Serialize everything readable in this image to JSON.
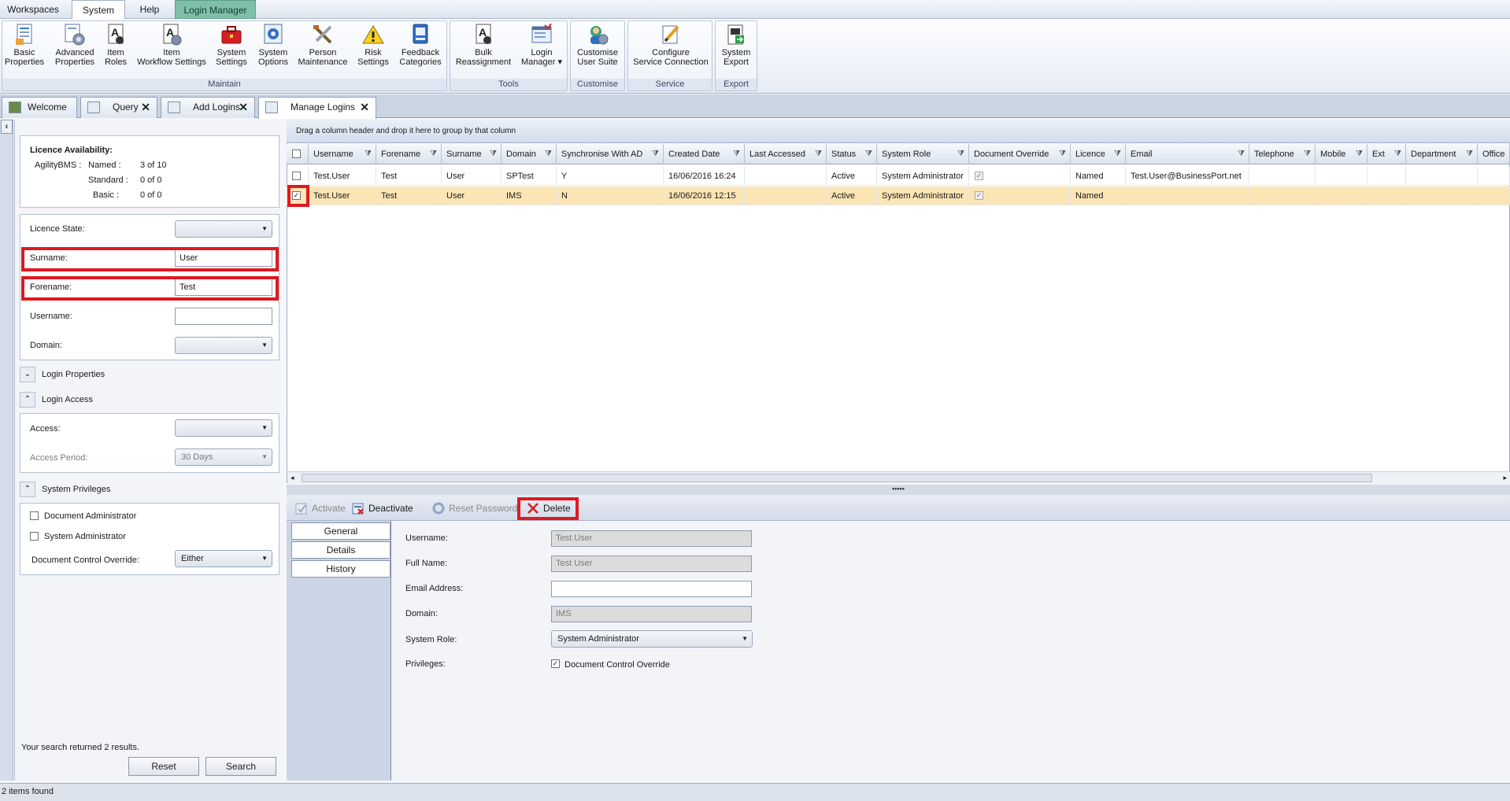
{
  "menu": {
    "tabs": [
      "Workspaces",
      "System",
      "Help",
      "Login Manager"
    ]
  },
  "ribbon": {
    "groups": [
      "Maintain",
      "Tools",
      "Customise",
      "Service",
      "Export"
    ],
    "buttons": [
      {
        "line1": "Basic",
        "line2": "Properties"
      },
      {
        "line1": "Advanced",
        "line2": "Properties"
      },
      {
        "line1": "Item",
        "line2": "Roles"
      },
      {
        "line1": "Item",
        "line2": "Workflow Settings"
      },
      {
        "line1": "System",
        "line2": "Settings"
      },
      {
        "line1": "System",
        "line2": "Options"
      },
      {
        "line1": "Person",
        "line2": "Maintenance"
      },
      {
        "line1": "Risk",
        "line2": "Settings"
      },
      {
        "line1": "Feedback",
        "line2": "Categories"
      },
      {
        "line1": "Bulk",
        "line2": "Reassignment"
      },
      {
        "line1": "Login",
        "line2": "Manager"
      },
      {
        "line1": "Customise",
        "line2": "User Suite"
      },
      {
        "line1": "Configure",
        "line2": "Service Connection"
      },
      {
        "line1": "System",
        "line2": "Export"
      }
    ]
  },
  "doc_tabs": [
    "Welcome",
    "Query",
    "Add Logins",
    "Manage Logins"
  ],
  "left": {
    "licence": {
      "title": "Licence Availability:",
      "product": "AgilityBMS :",
      "named_label": "Named :",
      "named_value": "3 of 10",
      "standard_label": "Standard :",
      "standard_value": "0 of 0",
      "basic_label": "Basic :",
      "basic_value": "0 of 0"
    },
    "filters": {
      "licence_state_label": "Licence State:",
      "licence_state_value": "",
      "surname_label": "Surname:",
      "surname_value": "User",
      "forename_label": "Forename:",
      "forename_value": "Test",
      "username_label": "Username:",
      "username_value": "",
      "domain_label": "Domain:",
      "domain_value": ""
    },
    "sections": {
      "login_properties": "Login Properties",
      "login_access": "Login Access",
      "system_privileges": "System Privileges"
    },
    "access": {
      "access_label": "Access:",
      "access_value": "",
      "period_label": "Access Period:",
      "period_value": "30 Days"
    },
    "privileges": {
      "doc_admin": "Document Administrator",
      "sys_admin": "System Administrator",
      "override_label": "Document Control Override:",
      "override_value": "Either"
    },
    "results_text": "Your search returned 2 results.",
    "reset_label": "Reset",
    "search_label": "Search"
  },
  "grid": {
    "group_hint": "Drag a column header and drop it here to group by that column",
    "columns": [
      "Username",
      "Forename",
      "Surname",
      "Domain",
      "Synchronise With AD",
      "Created Date",
      "Last Accessed",
      "Status",
      "System Role",
      "Document Override",
      "Licence",
      "Email",
      "Telephone",
      "Mobile",
      "Ext",
      "Department",
      "Office"
    ],
    "rows": [
      {
        "username": "Test.User",
        "forename": "Test",
        "surname": "User",
        "domain": "SPTest",
        "sync": "Y",
        "created": "16/06/2016 16:24",
        "last": "",
        "status": "Active",
        "role": "System Administrator",
        "override": true,
        "licence": "Named",
        "email": "Test.User@BusinessPort.net",
        "selected": false
      },
      {
        "username": "Test.User",
        "forename": "Test",
        "surname": "User",
        "domain": "IMS",
        "sync": "N",
        "created": "16/06/2016 12:15",
        "last": "",
        "status": "Active",
        "role": "System Administrator",
        "override": true,
        "licence": "Named",
        "email": "",
        "selected": true
      }
    ]
  },
  "splitter": "•••••",
  "actions": {
    "activate": "Activate",
    "deactivate": "Deactivate",
    "reset_password": "Reset Password",
    "delete": "Delete"
  },
  "detail": {
    "nav": [
      "General",
      "Details",
      "History"
    ],
    "username_label": "Username:",
    "username_value": "Test.User",
    "fullname_label": "Full Name:",
    "fullname_value": "Test User",
    "email_label": "Email Address:",
    "email_value": "",
    "domain_label": "Domain:",
    "domain_value": "IMS",
    "role_label": "System Role:",
    "role_value": "System Administrator",
    "privileges_label": "Privileges:",
    "privilege_option": "Document Control Override"
  },
  "status": "2 items found",
  "colors": {
    "highlight": "#e0191f",
    "selected_row": "#fce5b5",
    "login_manager_tab": "#7fbfa8"
  }
}
